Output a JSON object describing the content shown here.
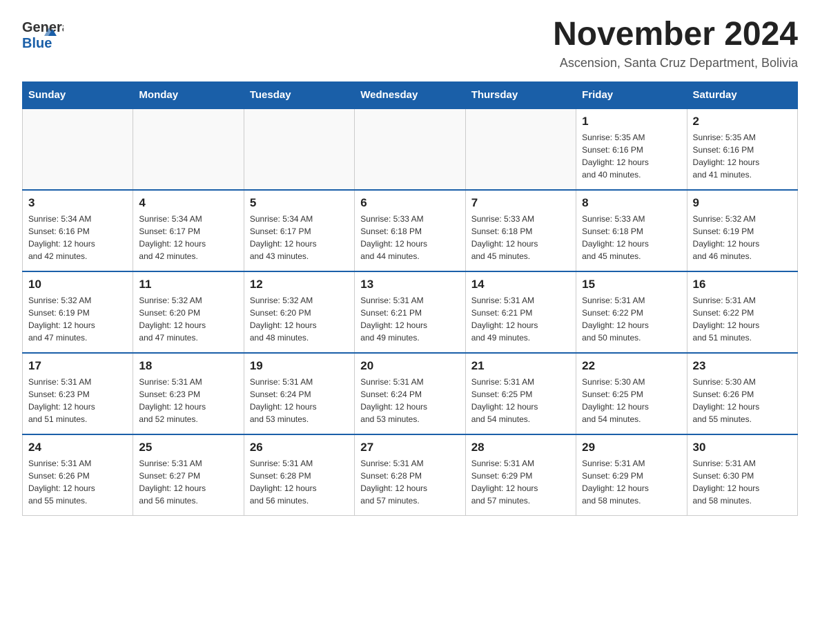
{
  "logo": {
    "general": "General",
    "blue": "Blue"
  },
  "title": "November 2024",
  "location": "Ascension, Santa Cruz Department, Bolivia",
  "days_of_week": [
    "Sunday",
    "Monday",
    "Tuesday",
    "Wednesday",
    "Thursday",
    "Friday",
    "Saturday"
  ],
  "weeks": [
    [
      {
        "day": "",
        "info": ""
      },
      {
        "day": "",
        "info": ""
      },
      {
        "day": "",
        "info": ""
      },
      {
        "day": "",
        "info": ""
      },
      {
        "day": "",
        "info": ""
      },
      {
        "day": "1",
        "info": "Sunrise: 5:35 AM\nSunset: 6:16 PM\nDaylight: 12 hours\nand 40 minutes."
      },
      {
        "day": "2",
        "info": "Sunrise: 5:35 AM\nSunset: 6:16 PM\nDaylight: 12 hours\nand 41 minutes."
      }
    ],
    [
      {
        "day": "3",
        "info": "Sunrise: 5:34 AM\nSunset: 6:16 PM\nDaylight: 12 hours\nand 42 minutes."
      },
      {
        "day": "4",
        "info": "Sunrise: 5:34 AM\nSunset: 6:17 PM\nDaylight: 12 hours\nand 42 minutes."
      },
      {
        "day": "5",
        "info": "Sunrise: 5:34 AM\nSunset: 6:17 PM\nDaylight: 12 hours\nand 43 minutes."
      },
      {
        "day": "6",
        "info": "Sunrise: 5:33 AM\nSunset: 6:18 PM\nDaylight: 12 hours\nand 44 minutes."
      },
      {
        "day": "7",
        "info": "Sunrise: 5:33 AM\nSunset: 6:18 PM\nDaylight: 12 hours\nand 45 minutes."
      },
      {
        "day": "8",
        "info": "Sunrise: 5:33 AM\nSunset: 6:18 PM\nDaylight: 12 hours\nand 45 minutes."
      },
      {
        "day": "9",
        "info": "Sunrise: 5:32 AM\nSunset: 6:19 PM\nDaylight: 12 hours\nand 46 minutes."
      }
    ],
    [
      {
        "day": "10",
        "info": "Sunrise: 5:32 AM\nSunset: 6:19 PM\nDaylight: 12 hours\nand 47 minutes."
      },
      {
        "day": "11",
        "info": "Sunrise: 5:32 AM\nSunset: 6:20 PM\nDaylight: 12 hours\nand 47 minutes."
      },
      {
        "day": "12",
        "info": "Sunrise: 5:32 AM\nSunset: 6:20 PM\nDaylight: 12 hours\nand 48 minutes."
      },
      {
        "day": "13",
        "info": "Sunrise: 5:31 AM\nSunset: 6:21 PM\nDaylight: 12 hours\nand 49 minutes."
      },
      {
        "day": "14",
        "info": "Sunrise: 5:31 AM\nSunset: 6:21 PM\nDaylight: 12 hours\nand 49 minutes."
      },
      {
        "day": "15",
        "info": "Sunrise: 5:31 AM\nSunset: 6:22 PM\nDaylight: 12 hours\nand 50 minutes."
      },
      {
        "day": "16",
        "info": "Sunrise: 5:31 AM\nSunset: 6:22 PM\nDaylight: 12 hours\nand 51 minutes."
      }
    ],
    [
      {
        "day": "17",
        "info": "Sunrise: 5:31 AM\nSunset: 6:23 PM\nDaylight: 12 hours\nand 51 minutes."
      },
      {
        "day": "18",
        "info": "Sunrise: 5:31 AM\nSunset: 6:23 PM\nDaylight: 12 hours\nand 52 minutes."
      },
      {
        "day": "19",
        "info": "Sunrise: 5:31 AM\nSunset: 6:24 PM\nDaylight: 12 hours\nand 53 minutes."
      },
      {
        "day": "20",
        "info": "Sunrise: 5:31 AM\nSunset: 6:24 PM\nDaylight: 12 hours\nand 53 minutes."
      },
      {
        "day": "21",
        "info": "Sunrise: 5:31 AM\nSunset: 6:25 PM\nDaylight: 12 hours\nand 54 minutes."
      },
      {
        "day": "22",
        "info": "Sunrise: 5:30 AM\nSunset: 6:25 PM\nDaylight: 12 hours\nand 54 minutes."
      },
      {
        "day": "23",
        "info": "Sunrise: 5:30 AM\nSunset: 6:26 PM\nDaylight: 12 hours\nand 55 minutes."
      }
    ],
    [
      {
        "day": "24",
        "info": "Sunrise: 5:31 AM\nSunset: 6:26 PM\nDaylight: 12 hours\nand 55 minutes."
      },
      {
        "day": "25",
        "info": "Sunrise: 5:31 AM\nSunset: 6:27 PM\nDaylight: 12 hours\nand 56 minutes."
      },
      {
        "day": "26",
        "info": "Sunrise: 5:31 AM\nSunset: 6:28 PM\nDaylight: 12 hours\nand 56 minutes."
      },
      {
        "day": "27",
        "info": "Sunrise: 5:31 AM\nSunset: 6:28 PM\nDaylight: 12 hours\nand 57 minutes."
      },
      {
        "day": "28",
        "info": "Sunrise: 5:31 AM\nSunset: 6:29 PM\nDaylight: 12 hours\nand 57 minutes."
      },
      {
        "day": "29",
        "info": "Sunrise: 5:31 AM\nSunset: 6:29 PM\nDaylight: 12 hours\nand 58 minutes."
      },
      {
        "day": "30",
        "info": "Sunrise: 5:31 AM\nSunset: 6:30 PM\nDaylight: 12 hours\nand 58 minutes."
      }
    ]
  ]
}
